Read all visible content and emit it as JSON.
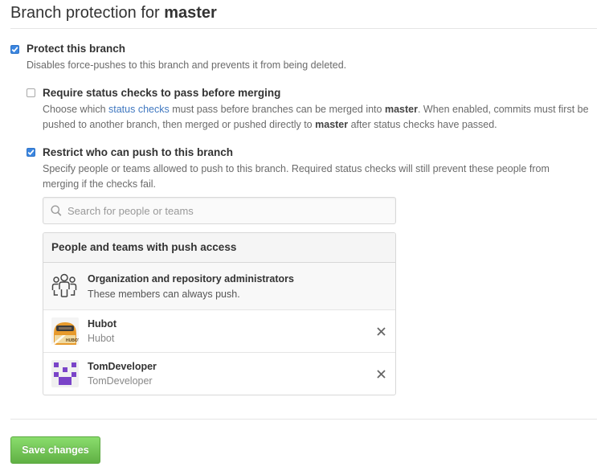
{
  "page": {
    "title_prefix": "Branch protection for",
    "branch": "master"
  },
  "protect": {
    "checked": true,
    "label": "Protect this branch",
    "description": "Disables force-pushes to this branch and prevents it from being deleted."
  },
  "status_checks": {
    "checked": false,
    "label": "Require status checks to pass before merging",
    "desc_part1": "Choose which",
    "desc_link": "status checks",
    "desc_part2": "must pass before branches can be merged into",
    "desc_branch1": "master",
    "desc_part3": ". When enabled, commits must first be pushed to another branch, then merged or pushed directly to",
    "desc_branch2": "master",
    "desc_part4": "after status checks have passed."
  },
  "restrict": {
    "checked": true,
    "label": "Restrict who can push to this branch",
    "description": "Specify people or teams allowed to push to this branch. Required status checks will still prevent these people from merging if the checks fail."
  },
  "search": {
    "placeholder": "Search for people or teams",
    "value": ""
  },
  "access": {
    "header": "People and teams with push access",
    "admin": {
      "name": "Organization and repository administrators",
      "note": "These members can always push.",
      "icon": "organization-icon"
    },
    "users": [
      {
        "name": "Hubot",
        "login": "Hubot",
        "avatar": "hubot-avatar"
      },
      {
        "name": "TomDeveloper",
        "login": "TomDeveloper",
        "avatar": "identicon-avatar"
      }
    ]
  },
  "actions": {
    "save_label": "Save changes"
  },
  "colors": {
    "checkbox": "#3b86e0",
    "link": "#4078c0",
    "save_button": "#60b044",
    "identicon": "#7a44c8"
  }
}
